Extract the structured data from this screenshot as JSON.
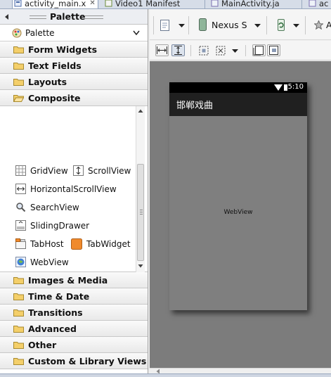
{
  "editor_tabs": [
    {
      "label": "activity_main.x",
      "close": "✕",
      "active": true
    },
    {
      "label": "Video1 Manifest",
      "active": false
    },
    {
      "label": "MainActivity.ja",
      "active": false
    },
    {
      "label": "ac",
      "active": false
    }
  ],
  "palette": {
    "title": "Palette",
    "selector_label": "Palette",
    "categories_top": [
      "Form Widgets",
      "Text Fields",
      "Layouts",
      "Composite"
    ],
    "composite_items": [
      "GridView",
      "ScrollView",
      "HorizontalScrollView",
      "SearchView",
      "SlidingDrawer",
      "TabHost",
      "TabWidget",
      "WebView"
    ],
    "categories_bottom": [
      "Images & Media",
      "Time & Date",
      "Transitions",
      "Advanced",
      "Other",
      "Custom & Library Views"
    ]
  },
  "toolbar": {
    "device_label": "Nexus S",
    "theme_label_partial": "A"
  },
  "device_preview": {
    "status_time": "5:10",
    "app_title": "邯郸戏曲",
    "webview_label": "WebView"
  },
  "colors": {
    "canvas": "#7c7c7c",
    "device_screen": "#7f7f7f",
    "action_bar": "#202020",
    "folder": "#f4cf6a"
  }
}
